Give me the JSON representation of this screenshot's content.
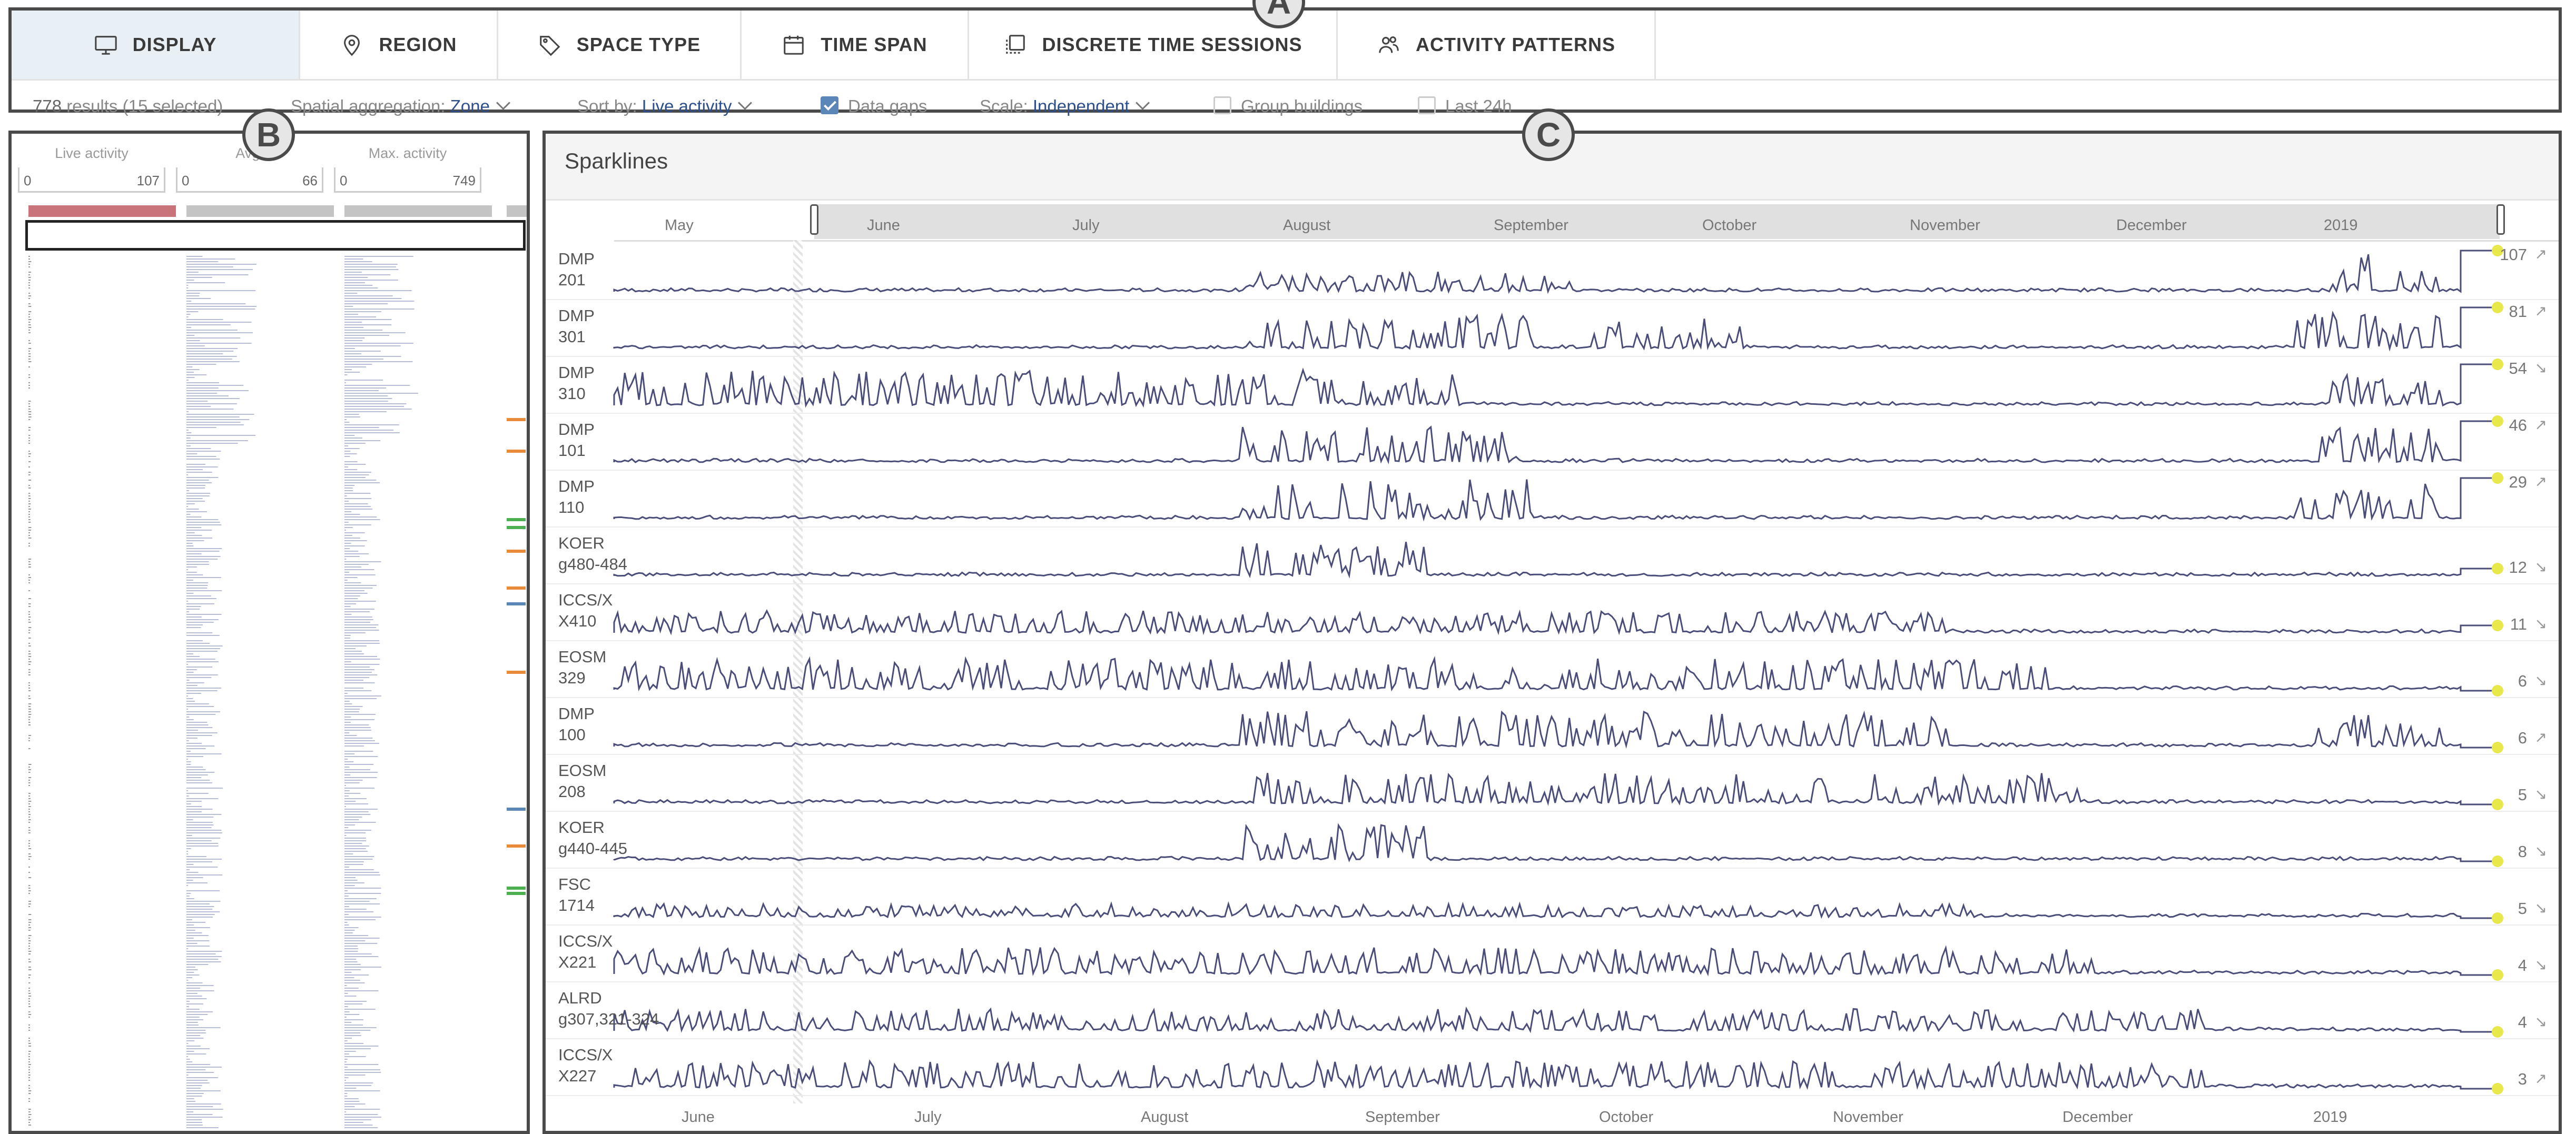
{
  "tabs": [
    {
      "label": "DISPLAY",
      "icon": "monitor-icon",
      "active": true
    },
    {
      "label": "REGION",
      "icon": "location-pin-icon",
      "active": false
    },
    {
      "label": "SPACE TYPE",
      "icon": "tag-icon",
      "active": false
    },
    {
      "label": "TIME SPAN",
      "icon": "calendar-icon",
      "active": false
    },
    {
      "label": "DISCRETE TIME SESSIONS",
      "icon": "sessions-icon",
      "active": false
    },
    {
      "label": "ACTIVITY PATTERNS",
      "icon": "people-icon",
      "active": false
    }
  ],
  "toolbar": {
    "results_count": "778",
    "results_suffix": "results (15 selected)",
    "spatial_label": "Spatial aggregation:",
    "spatial_value": "Zone",
    "sort_label": "Sort by:",
    "sort_value": "Live activity",
    "data_gaps_label": "Data gaps",
    "data_gaps_checked": true,
    "scale_label": "Scale:",
    "scale_value": "Independent",
    "group_buildings_label": "Group buildings",
    "group_buildings_checked": false,
    "last24_label": "Last 24h",
    "last24_checked": false
  },
  "badges": {
    "a": "A",
    "b": "B",
    "c": "C"
  },
  "table_panel": {
    "columns": [
      {
        "label": "Live activity",
        "min": "0",
        "max": "107",
        "bar_color": "#c9737b"
      },
      {
        "label": "Avg.",
        "min": "0",
        "max": "66",
        "bar_color": "#bdbdbd"
      },
      {
        "label": "Max. activity",
        "min": "0",
        "max": "749",
        "bar_color": "#bdbdbd"
      }
    ]
  },
  "sparklines": {
    "title": "Sparklines",
    "top_months": [
      "May",
      "June",
      "July",
      "August",
      "September",
      "October",
      "November",
      "December",
      "2019"
    ],
    "bottom_months": [
      "June",
      "July",
      "August",
      "September",
      "October",
      "November",
      "December",
      "2019"
    ],
    "line_color": "#4a4d7a",
    "endpoint_color": "#e8e84a",
    "rows": [
      {
        "label": "DMP\n201",
        "value": "107",
        "trend": "↗"
      },
      {
        "label": "DMP\n301",
        "value": "81",
        "trend": "↗"
      },
      {
        "label": "DMP\n310",
        "value": "54",
        "trend": "↘"
      },
      {
        "label": "DMP\n101",
        "value": "46",
        "trend": "↗"
      },
      {
        "label": "DMP\n110",
        "value": "29",
        "trend": "↗"
      },
      {
        "label": "KOER\ng480-484",
        "value": "12",
        "trend": "↘"
      },
      {
        "label": "ICCS/X\nX410",
        "value": "11",
        "trend": "↘"
      },
      {
        "label": "EOSM\n329",
        "value": "6",
        "trend": "↘"
      },
      {
        "label": "DMP\n100",
        "value": "6",
        "trend": "↗"
      },
      {
        "label": "EOSM\n208",
        "value": "5",
        "trend": "↘"
      },
      {
        "label": "KOER\ng440-445",
        "value": "8",
        "trend": "↘"
      },
      {
        "label": "FSC\n1714",
        "value": "5",
        "trend": "↘"
      },
      {
        "label": "ICCS/X\nX221",
        "value": "4",
        "trend": "↘"
      },
      {
        "label": "ALRD\ng307,321-324",
        "value": "4",
        "trend": "↘"
      },
      {
        "label": "ICCS/X\nX227",
        "value": "3",
        "trend": "↗"
      }
    ]
  }
}
